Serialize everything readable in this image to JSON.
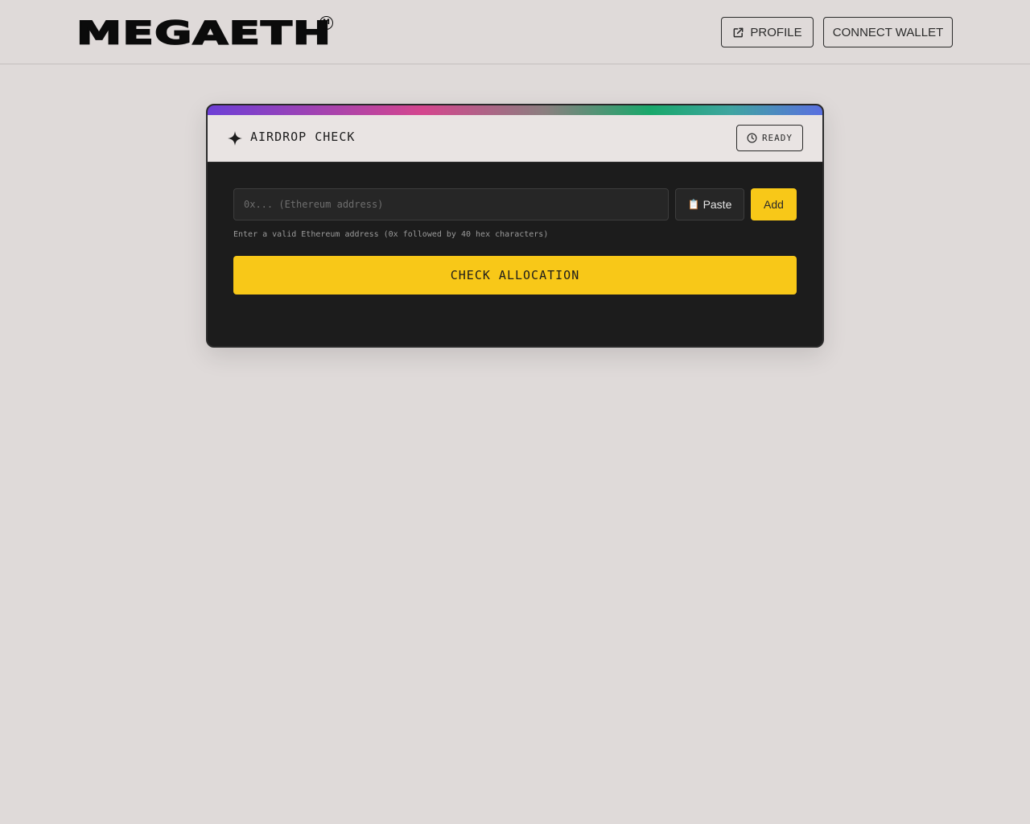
{
  "header": {
    "logo_text": "MEGAETH",
    "logo_mark": "M",
    "profile_label": "PROFILE",
    "connect_wallet_label": "CONNECT WALLET"
  },
  "card": {
    "title": "AIRDROP CHECK",
    "status": "READY",
    "address_placeholder": "0x... (Ethereum address)",
    "address_value": "",
    "paste_label": "Paste",
    "add_label": "Add",
    "hint": "Enter a valid Ethereum address (0x followed by 40 hex characters)",
    "check_label": "CHECK ALLOCATION"
  },
  "icons": {
    "profile": "external-link-icon",
    "title": "sparkle-icon",
    "status": "clock-icon",
    "paste": "clipboard-icon"
  },
  "colors": {
    "background": "#dfdad9",
    "card": "#1c1c1c",
    "accent": "#f8c818"
  }
}
